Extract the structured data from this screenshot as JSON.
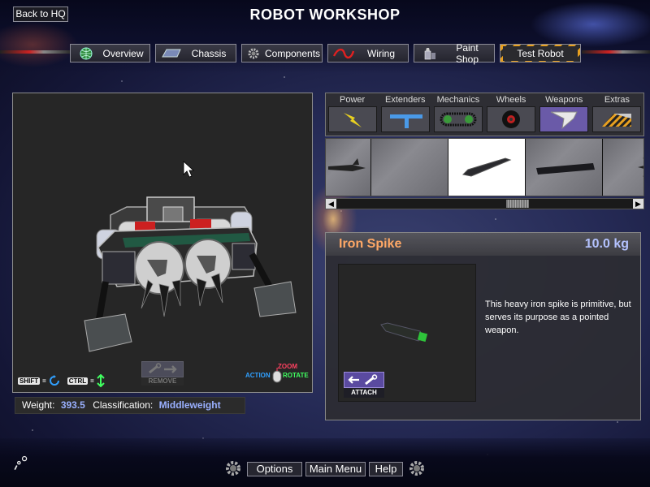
{
  "header": {
    "title": "ROBOT WORKSHOP",
    "back_label": "Back to HQ"
  },
  "nav": [
    {
      "label": "Overview",
      "icon": "globe-icon"
    },
    {
      "label": "Chassis",
      "icon": "chassis-icon"
    },
    {
      "label": "Components",
      "icon": "gear-icon"
    },
    {
      "label": "Wiring",
      "icon": "wire-icon"
    },
    {
      "label": "Paint Shop",
      "icon": "paint-can-icon"
    },
    {
      "label": "Test Robot",
      "icon": "hazard-stripes"
    }
  ],
  "categories": [
    {
      "label": "Power",
      "icon": "lightning-icon"
    },
    {
      "label": "Extenders",
      "icon": "extender-bar-icon"
    },
    {
      "label": "Mechanics",
      "icon": "chain-drive-icon"
    },
    {
      "label": "Wheels",
      "icon": "wheel-icon"
    },
    {
      "label": "Weapons",
      "icon": "blade-icon",
      "selected": true
    },
    {
      "label": "Extras",
      "icon": "hazard-ramp-icon"
    }
  ],
  "parts_strip": [
    {
      "icon": "spiked-blade-icon"
    },
    {
      "icon": "empty-slot"
    },
    {
      "icon": "iron-spike-icon",
      "selected": true
    },
    {
      "icon": "flat-blade-icon"
    },
    {
      "icon": "spiked-ball-icon"
    }
  ],
  "detail": {
    "name": "Iron Spike",
    "weight": "10.0 kg",
    "description": "This heavy iron spike is primitive, but serves its purpose as a pointed weapon.",
    "attach_label": "ATTACH"
  },
  "viewport": {
    "remove_label": "REMOVE",
    "shift_key": "SHIFT",
    "ctrl_key": "CTRL",
    "action_label": "ACTION",
    "zoom_label": "ZOOM",
    "rotate_label": "ROTATE"
  },
  "status": {
    "weight_label": "Weight:",
    "weight_value": "393.5",
    "class_label": "Classification:",
    "class_value": "Middleweight"
  },
  "footer": {
    "options_label": "Options",
    "main_menu_label": "Main Menu",
    "help_label": "Help"
  },
  "colors": {
    "part_name": "#ffa866",
    "weight_value": "#b4c2ff",
    "selected_category": "#6a5aa8",
    "zoom": "#ff4060",
    "rotate": "#40ff60",
    "action": "#30a0ff"
  }
}
